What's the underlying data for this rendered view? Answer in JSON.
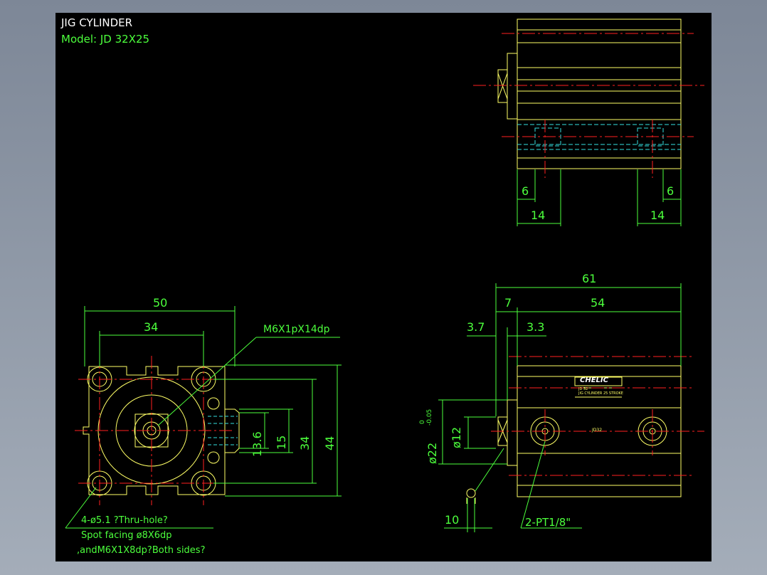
{
  "title": "JIG CYLINDER",
  "model": "Model: JD 32X25",
  "colors": {
    "background": "#000000",
    "outline": "#ffff66",
    "centerline": "#ff2020",
    "dimension": "#4cff3c",
    "hidden": "#33e0e0",
    "text_white": "#ffffff"
  },
  "top_view": {
    "dim_left_small": "6",
    "dim_right_small": "6",
    "dim_left": "14",
    "dim_right": "14"
  },
  "front_view": {
    "width_outer": "50",
    "width_holes": "34",
    "height_slot": "13.6",
    "height_15": "15",
    "height_holes": "34",
    "height_outer": "44",
    "thread_callout": "M6X1pX14dp"
  },
  "front_notes": {
    "line1": "4-ø5.1 ?Thru-hole?",
    "line2": "Spot facing ø8X6dp",
    "line3": ",andM6X1X8dp?Both sides?"
  },
  "side_view": {
    "overall_length": "61",
    "body_length": "54",
    "head_length": "7",
    "dim_3_7": "3.7",
    "dim_3_3": "3.3",
    "dim_10": "10",
    "port_callout": "2-PT1/8\"",
    "rod_dia": "ø12",
    "head_dia": "ø22",
    "tol_upper": "0",
    "tol_lower": "-0.05",
    "brand": "CHELIC",
    "label_line1": "JD 32",
    "label_line2": "JIG CYLINDER  25 STROKE",
    "body_mark": "JD32"
  }
}
